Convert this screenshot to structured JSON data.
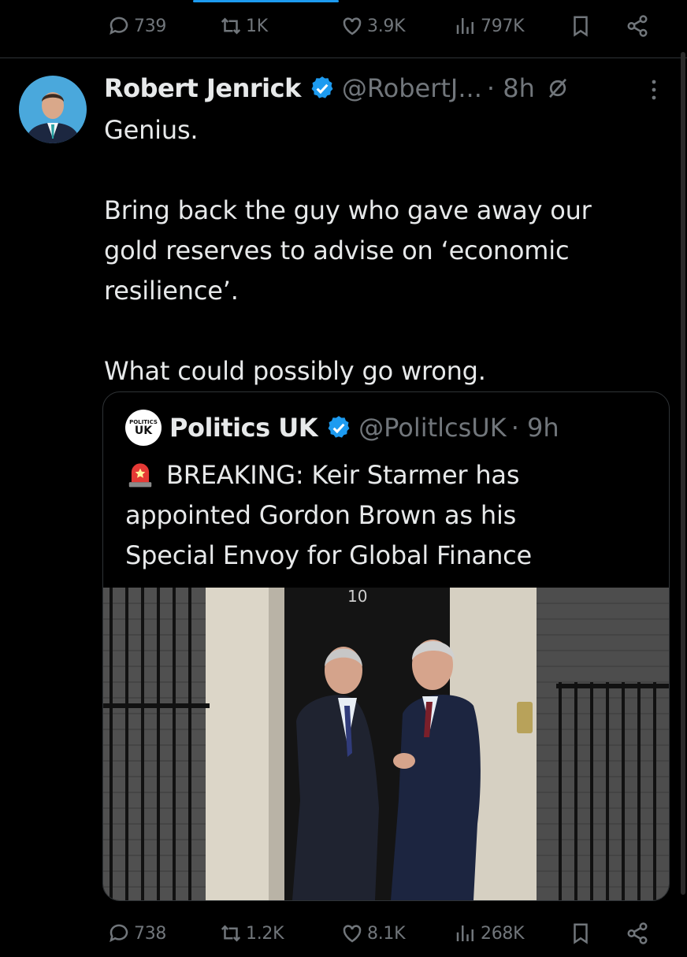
{
  "top_actions": {
    "replies": "739",
    "reposts": "1K",
    "likes": "3.9K",
    "views": "797K"
  },
  "post": {
    "author_name": "Robert Jenrick",
    "handle": "@RobertJ...",
    "time": "· 8h",
    "text": "Genius.\n\nBring back the guy who gave away our\ngold reserves to advise on ‘economic\nresilience’.\n\nWhat could possibly go wrong."
  },
  "quoted": {
    "avatar_top": "POLITICS",
    "avatar_bottom": "UK",
    "author_name": "Politics UK",
    "handle": "@PolitlcsUK",
    "time": "· 9h",
    "text": "BREAKING: Keir Starmer has\nappointed Gordon Brown as his\nSpecial Envoy for Global Finance",
    "door_number": "10"
  },
  "bottom_actions": {
    "replies": "738",
    "reposts": "1.2K",
    "likes": "8.1K",
    "views": "268K"
  },
  "colors": {
    "accent": "#1d9bf0",
    "muted": "#71767b",
    "text": "#e7e9ea",
    "border": "#2f3336"
  }
}
